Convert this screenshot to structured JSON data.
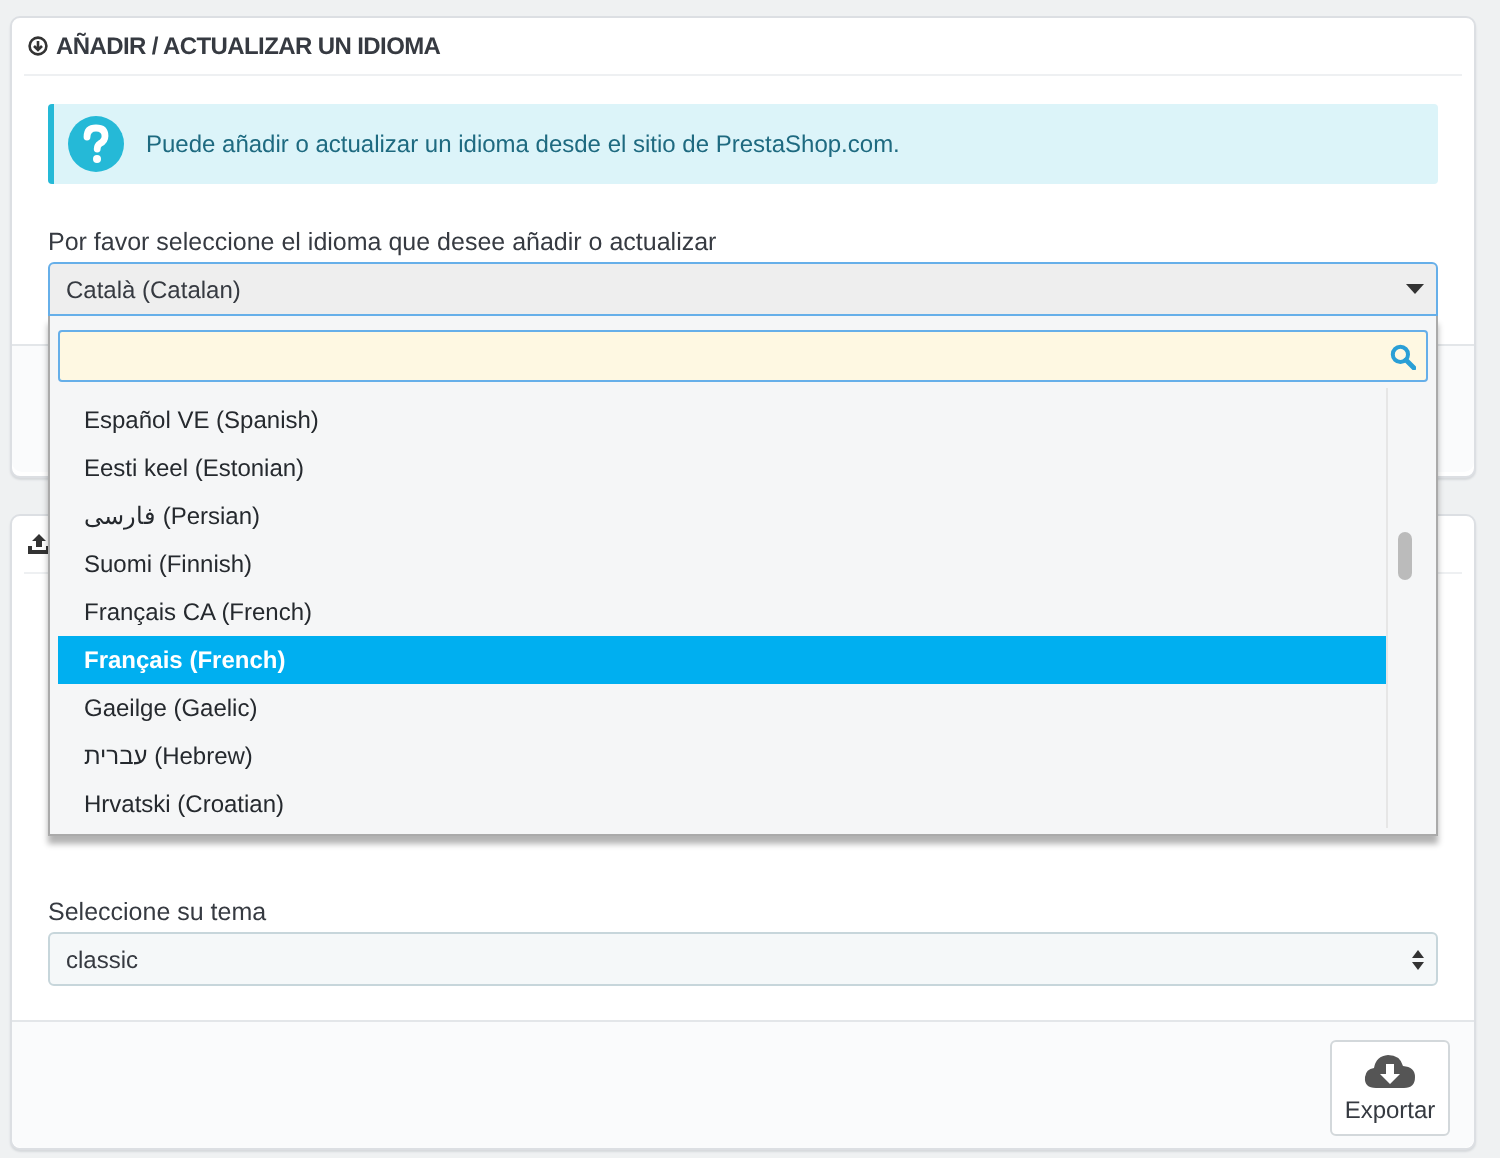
{
  "add_panel": {
    "title": "AÑADIR / ACTUALIZAR UN IDIOMA",
    "info": "Puede añadir o actualizar un idioma desde el sitio de PrestaShop.com.",
    "language_select": {
      "label": "Por favor seleccione el idioma que desee añadir o actualizar",
      "value": "Català (Catalan)",
      "expanded": true,
      "options": [
        {
          "label": "Español VE (Spanish)",
          "selected": false
        },
        {
          "label": "Eesti keel (Estonian)",
          "selected": false
        },
        {
          "label": "فارسی (Persian)",
          "selected": false
        },
        {
          "label": "Suomi (Finnish)",
          "selected": false
        },
        {
          "label": "Français CA (French)",
          "selected": false
        },
        {
          "label": "Français (French)",
          "selected": true
        },
        {
          "label": "Gaeilge (Gaelic)",
          "selected": false
        },
        {
          "label": "עברית (Hebrew)",
          "selected": false
        },
        {
          "label": "Hrvatski (Croatian)",
          "selected": false
        }
      ]
    }
  },
  "export_panel": {
    "theme_select": {
      "label": "Seleccione su tema",
      "value": "classic"
    },
    "buttons": [
      {
        "label": "Exportar"
      }
    ]
  }
}
